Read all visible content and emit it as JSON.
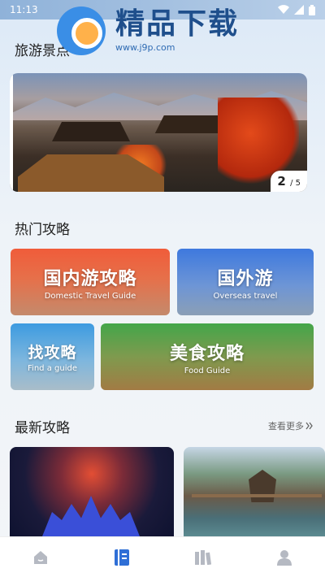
{
  "status_bar": {
    "time": "11:13"
  },
  "watermark": {
    "title": "精品下载",
    "url": "www.j9p.com"
  },
  "banner": {
    "section_title": "旅游景点",
    "current": "2",
    "total": "/ 5"
  },
  "hot": {
    "section_title": "热门攻略",
    "cards": [
      {
        "title": "国内游攻略",
        "subtitle": "Domestic Travel Guide"
      },
      {
        "title": "国外游",
        "subtitle": "Overseas travel"
      },
      {
        "title": "找攻略",
        "subtitle": "Find a guide"
      },
      {
        "title": "美食攻略",
        "subtitle": "Food Guide"
      }
    ]
  },
  "latest": {
    "section_title": "最新攻略",
    "more_label": "查看更多"
  },
  "tabbar": {
    "icons": [
      "home-icon",
      "guide-book-icon",
      "library-icon",
      "profile-icon"
    ],
    "active": "guide-book-icon"
  },
  "colors": {
    "accent": "#2f6fd6",
    "inactive": "#b5b9c2"
  }
}
